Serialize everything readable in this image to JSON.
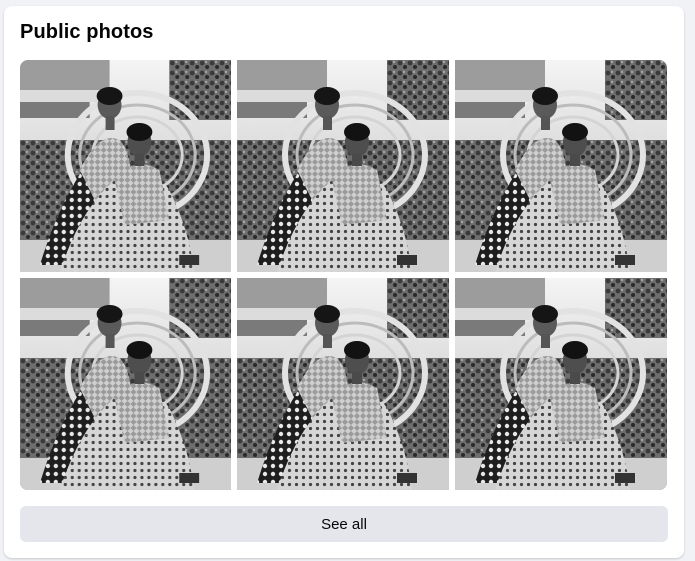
{
  "section": {
    "title": "Public photos",
    "see_all_label": "See all"
  },
  "photos": [
    {
      "alt": "photo-1"
    },
    {
      "alt": "photo-2"
    },
    {
      "alt": "photo-3"
    },
    {
      "alt": "photo-4"
    },
    {
      "alt": "photo-5"
    },
    {
      "alt": "photo-6"
    }
  ],
  "colors": {
    "page_bg": "#f0f2f5",
    "card_bg": "#ffffff",
    "button_bg": "#e4e6eb",
    "text": "#050505"
  }
}
